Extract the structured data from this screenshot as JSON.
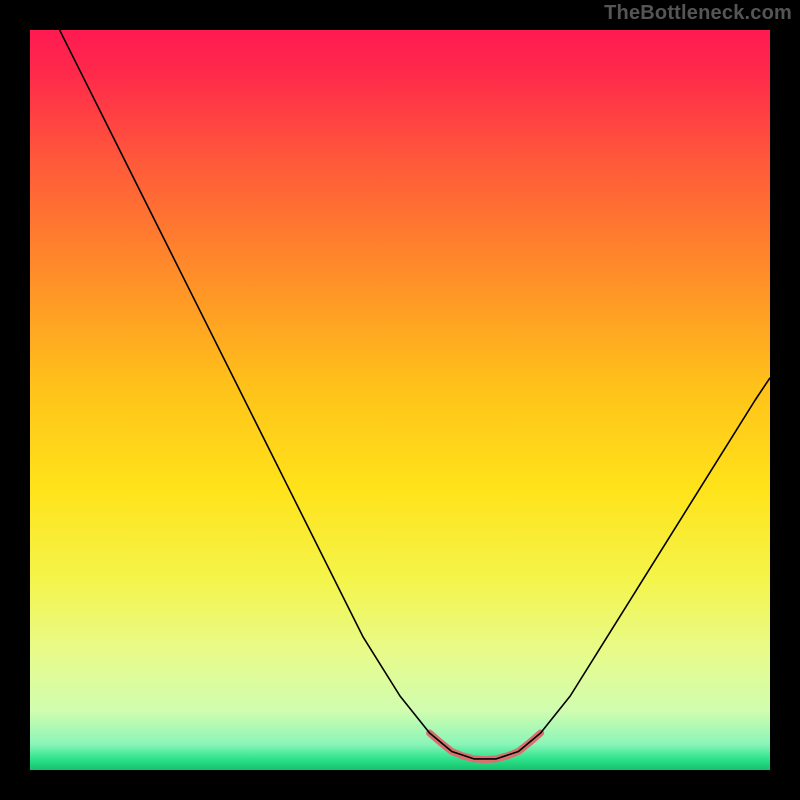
{
  "watermark": "TheBottleneck.com",
  "chart_data": {
    "type": "line",
    "title": "",
    "xlabel": "",
    "ylabel": "",
    "xlim": [
      0,
      100
    ],
    "ylim": [
      0,
      100
    ],
    "background_gradient_stops": [
      {
        "offset": 0.0,
        "color": "#ff1a52"
      },
      {
        "offset": 0.06,
        "color": "#ff2a4a"
      },
      {
        "offset": 0.18,
        "color": "#ff5a3a"
      },
      {
        "offset": 0.32,
        "color": "#ff8a2a"
      },
      {
        "offset": 0.48,
        "color": "#ffc11a"
      },
      {
        "offset": 0.62,
        "color": "#ffe31a"
      },
      {
        "offset": 0.74,
        "color": "#f4f44a"
      },
      {
        "offset": 0.84,
        "color": "#e8fb8a"
      },
      {
        "offset": 0.92,
        "color": "#d0fdb0"
      },
      {
        "offset": 0.965,
        "color": "#8af5b8"
      },
      {
        "offset": 0.985,
        "color": "#2ee38c"
      },
      {
        "offset": 1.0,
        "color": "#14c26a"
      }
    ],
    "series": [
      {
        "name": "bottleneck-curve",
        "color": "#000000",
        "width": 1.6,
        "points": [
          {
            "x": 4,
            "y": 100
          },
          {
            "x": 8,
            "y": 92
          },
          {
            "x": 12,
            "y": 84
          },
          {
            "x": 16,
            "y": 76
          },
          {
            "x": 20,
            "y": 68
          },
          {
            "x": 25,
            "y": 58
          },
          {
            "x": 30,
            "y": 48
          },
          {
            "x": 35,
            "y": 38
          },
          {
            "x": 40,
            "y": 28
          },
          {
            "x": 45,
            "y": 18
          },
          {
            "x": 50,
            "y": 10
          },
          {
            "x": 54,
            "y": 5
          },
          {
            "x": 57,
            "y": 2.5
          },
          {
            "x": 60,
            "y": 1.5
          },
          {
            "x": 63,
            "y": 1.5
          },
          {
            "x": 66,
            "y": 2.5
          },
          {
            "x": 69,
            "y": 5
          },
          {
            "x": 73,
            "y": 10
          },
          {
            "x": 78,
            "y": 18
          },
          {
            "x": 83,
            "y": 26
          },
          {
            "x": 88,
            "y": 34
          },
          {
            "x": 93,
            "y": 42
          },
          {
            "x": 98,
            "y": 50
          },
          {
            "x": 100,
            "y": 53
          }
        ]
      },
      {
        "name": "bottom-highlight",
        "color": "#d87070",
        "width": 7,
        "linecap": "round",
        "points": [
          {
            "x": 54,
            "y": 5
          },
          {
            "x": 55.5,
            "y": 3.7
          },
          {
            "x": 57,
            "y": 2.5
          },
          {
            "x": 58.5,
            "y": 1.9
          },
          {
            "x": 60,
            "y": 1.5
          },
          {
            "x": 61.5,
            "y": 1.4
          },
          {
            "x": 63,
            "y": 1.5
          },
          {
            "x": 64.5,
            "y": 1.9
          },
          {
            "x": 66,
            "y": 2.5
          },
          {
            "x": 67.5,
            "y": 3.7
          },
          {
            "x": 69,
            "y": 5
          }
        ]
      }
    ]
  }
}
